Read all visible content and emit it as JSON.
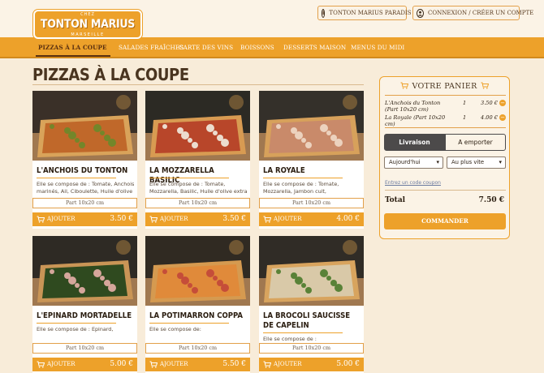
{
  "header": {
    "logo": {
      "chez": "CHEZ",
      "name": "TONTON MARIUS",
      "city": "MARSEILLE"
    },
    "paradis_label": "TONTON MARIUS PARADIS",
    "login_label": "CONNEXION / CRÉER UN COMPTE"
  },
  "nav": {
    "items": [
      {
        "label": "PIZZAS À LA COUPE",
        "active": true
      },
      {
        "label": "SALADES FRAÎCHES"
      },
      {
        "label": "CARTE DES VINS"
      },
      {
        "label": "BOISSONS"
      },
      {
        "label": "DESSERTS MAISON"
      },
      {
        "label": "MENUS DU MIDI"
      }
    ]
  },
  "page": {
    "title": "PIZZAS À LA COUPE"
  },
  "products": [
    {
      "name": "L'ANCHOIS DU TONTON",
      "description": "Elle se compose de : Tomate, Anchois marinés, Ail, Ciboulette, Huile d'olive",
      "portion": "Part 10x20 cm",
      "add_label": "AJOUTER",
      "price": "3.50 €"
    },
    {
      "name": "LA MOZZARELLA BASILIC",
      "description": "Elle se compose de : Tomate, Mozzarella, Basilic, Huile d'olive extra",
      "portion": "Part 10x20 cm",
      "add_label": "AJOUTER",
      "price": "3.50 €"
    },
    {
      "name": "LA ROYALE",
      "description": "Elle se compose de : Tomate, Mozzarella, Jambon cuit,",
      "portion": "Part 10x20 cm",
      "add_label": "AJOUTER",
      "price": "4.00 €"
    },
    {
      "name": "L'EPINARD MORTADELLE",
      "description": "Elle se compose de : Epinard,",
      "portion": "Part 10x20 cm",
      "add_label": "AJOUTER",
      "price": "5.00 €"
    },
    {
      "name": "LA POTIMARRON COPPA",
      "description": "Elle se compose de:",
      "portion": "Part 10x20 cm",
      "add_label": "AJOUTER",
      "price": "5.50 €"
    },
    {
      "name": "LA BROCOLI SAUCISSE DE CAPELIN",
      "description": "Elle se compose de :",
      "portion": "Part 10x20 cm",
      "add_label": "AJOUTER",
      "price": "5.00 €"
    }
  ],
  "cart": {
    "title": "VOTRE PANIER",
    "lines": [
      {
        "name": "L'Anchois du Tonton (Part 10x20 cm)",
        "qty": "1",
        "price": "3.50 €",
        "remove": "−"
      },
      {
        "name": "La Royale (Part 10x20 cm)",
        "qty": "1",
        "price": "4.00 €",
        "remove": "−"
      }
    ],
    "delivery_label": "Livraison",
    "takeaway_label": "A emporter",
    "day_select": "Aujourd'hui",
    "time_select": "Au plus vite",
    "coupon_link": "Entrez un code coupon",
    "total_label": "Total",
    "total_value": "7.50 €",
    "order_label": "COMMANDER"
  },
  "colors": {
    "accent": "#eda12a",
    "background": "#f8ecd9",
    "dark_toggle": "#4c4a4a"
  }
}
